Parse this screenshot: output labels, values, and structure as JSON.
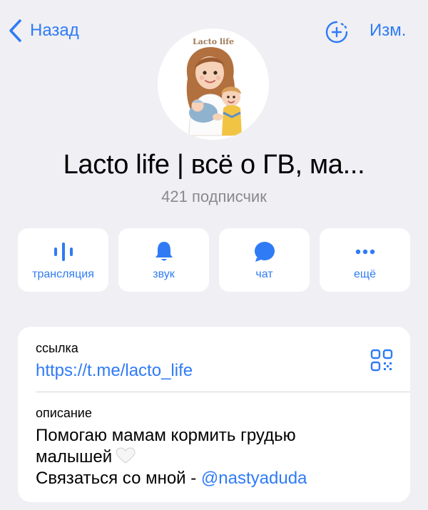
{
  "nav": {
    "back_label": "Назад",
    "edit_label": "Изм."
  },
  "channel": {
    "avatar_logo": "Lacto life",
    "title": "Lacto life | всё о ГВ, ма...",
    "subscribers": "421 подписчик"
  },
  "actions": [
    {
      "label": "трансляция",
      "icon": "broadcast-icon"
    },
    {
      "label": "звук",
      "icon": "bell-icon"
    },
    {
      "label": "чат",
      "icon": "chat-bubble-icon"
    },
    {
      "label": "ещё",
      "icon": "more-dots-icon"
    }
  ],
  "info": {
    "link_caption": "ссылка",
    "link_value": "https://t.me/lacto_life",
    "description_caption": "описание",
    "description_line1": "Помогаю мамам кормить грудью",
    "description_line2": "малышей",
    "description_line3_prefix": "Связаться со мной - ",
    "description_mention": "@nastyaduda"
  },
  "colors": {
    "accent": "#2f7bf5",
    "background": "#efeff4",
    "card": "#ffffff",
    "secondary_text": "#8a8a8e"
  }
}
